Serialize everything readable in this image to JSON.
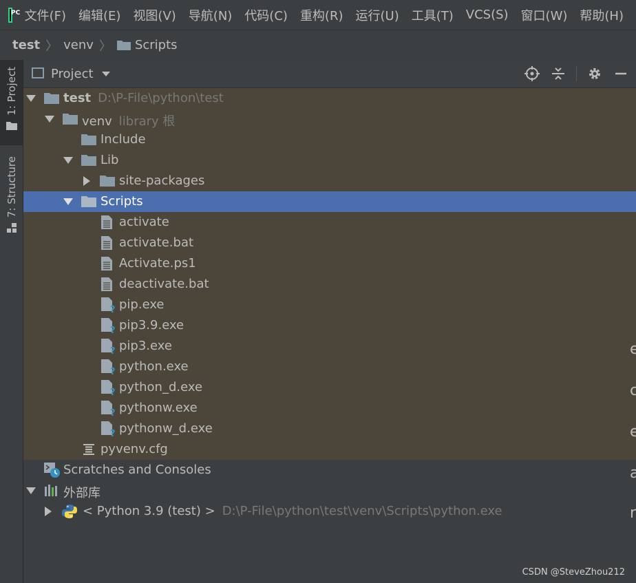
{
  "app": {
    "logo_text": "PC"
  },
  "menu": [
    "文件(F)",
    "编辑(E)",
    "视图(V)",
    "导航(N)",
    "代码(C)",
    "重构(R)",
    "运行(U)",
    "工具(T)",
    "VCS(S)",
    "窗口(W)",
    "帮助(H)"
  ],
  "breadcrumb": {
    "root": "test",
    "mid": "venv",
    "leaf": "Scripts"
  },
  "tool_tabs": {
    "project": "1: Project",
    "structure": "7: Structure"
  },
  "panel": {
    "title": "Project"
  },
  "tree": [
    {
      "label": "test",
      "hint": "D:\\P-File\\python\\test"
    },
    {
      "label": "venv",
      "hint": "library 根"
    },
    {
      "label": "Include"
    },
    {
      "label": "Lib"
    },
    {
      "label": "site-packages"
    },
    {
      "label": "Scripts"
    },
    {
      "label": "activate"
    },
    {
      "label": "activate.bat"
    },
    {
      "label": "Activate.ps1"
    },
    {
      "label": "deactivate.bat"
    },
    {
      "label": "pip.exe"
    },
    {
      "label": "pip3.9.exe"
    },
    {
      "label": "pip3.exe"
    },
    {
      "label": "python.exe"
    },
    {
      "label": "python_d.exe"
    },
    {
      "label": "pythonw.exe"
    },
    {
      "label": "pythonw_d.exe"
    },
    {
      "label": "pyvenv.cfg"
    },
    {
      "label": "Scratches and Consoles"
    },
    {
      "label": "外部库"
    },
    {
      "label": "< Python 3.9 (test) >",
      "hint": "D:\\P-File\\python\\test\\venv\\Scripts\\python.exe"
    }
  ],
  "edge_letters": [
    "e",
    "c",
    "e",
    "a",
    "r"
  ],
  "watermark": "CSDN @SteveZhou212",
  "colors": {
    "selection": "#4b6eaf",
    "shaded_row": "#4b4639",
    "background": "#3c3f41",
    "folder": "#8a9ba8"
  }
}
